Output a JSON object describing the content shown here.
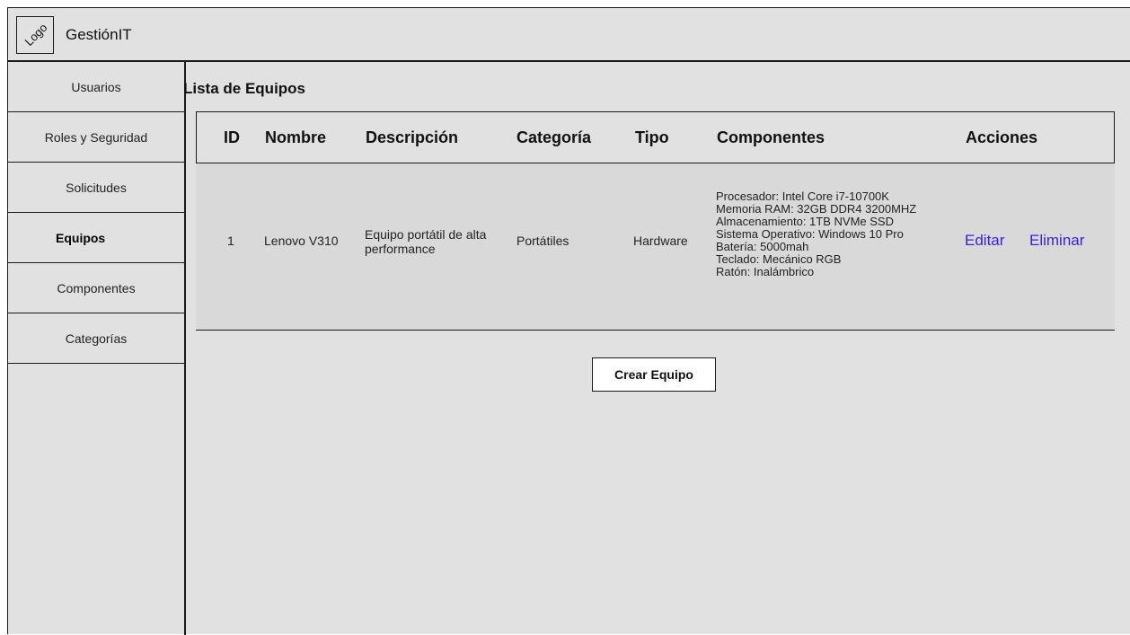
{
  "header": {
    "logo_text": "Logo",
    "app_title": "GestiónIT"
  },
  "sidebar": {
    "items": [
      {
        "label": "Usuarios",
        "active": false
      },
      {
        "label": "Roles y Seguridad",
        "active": false
      },
      {
        "label": "Solicitudes",
        "active": false
      },
      {
        "label": "Equipos",
        "active": true
      },
      {
        "label": "Componentes",
        "active": false
      },
      {
        "label": "Categorías",
        "active": false
      }
    ]
  },
  "main": {
    "title": "Lista de Equipos",
    "table": {
      "headers": [
        "ID",
        "Nombre",
        "Descripción",
        "Categoría",
        "Tipo",
        "Componentes",
        "Acciones"
      ],
      "rows": [
        {
          "id": "1",
          "nombre": "Lenovo V310",
          "descripcion_1": "Equipo portátil de alta",
          "descripcion_2": "performance",
          "categoria": "Portátiles",
          "tipo": "Hardware",
          "componentes": [
            "Procesador: Intel Core i7-10700K",
            "Memoria RAM: 32GB DDR4 3200MHZ",
            "Almacenamiento: 1TB NVMe SSD",
            "Sistema Operativo: Windows 10 Pro",
            "Batería: 5000mah",
            "Teclado: Mecánico RGB",
            "Ratón: Inalámbrico"
          ],
          "actions": {
            "edit": "Editar",
            "delete": "Eliminar"
          }
        }
      ]
    },
    "create_button": "Crear Equipo"
  },
  "colors": {
    "background": "#e1e1e1",
    "row_background": "#d9d9d9",
    "link": "#3a1ee0",
    "border": "#1a1a1a"
  }
}
